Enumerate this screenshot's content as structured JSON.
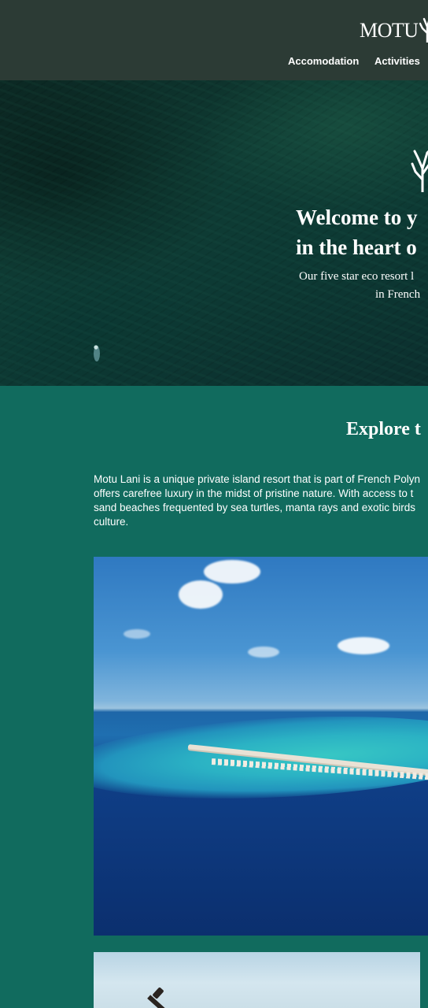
{
  "header": {
    "logo_text": "MOTU",
    "logo_icon": "coral-icon",
    "nav": [
      {
        "label": "Accomodation"
      },
      {
        "label": "Activities"
      }
    ]
  },
  "hero": {
    "icon": "coral-icon",
    "title_line1": "Welcome to y",
    "title_line2": "in the heart o",
    "subtitle_line1": "Our five star eco resort l",
    "subtitle_line2": "in French"
  },
  "explore": {
    "title": "Explore t",
    "intro_lines": [
      "Motu Lani is a unique private island resort that is part of French Polyn",
      "offers carefree luxury in the midst of pristine nature. With access to t",
      "sand beaches frequented by sea turtles, manta rays and exotic birds",
      "culture."
    ]
  },
  "colors": {
    "header_bg": "#2c3b35",
    "section_bg": "#116b5e",
    "text": "#ffffff"
  }
}
